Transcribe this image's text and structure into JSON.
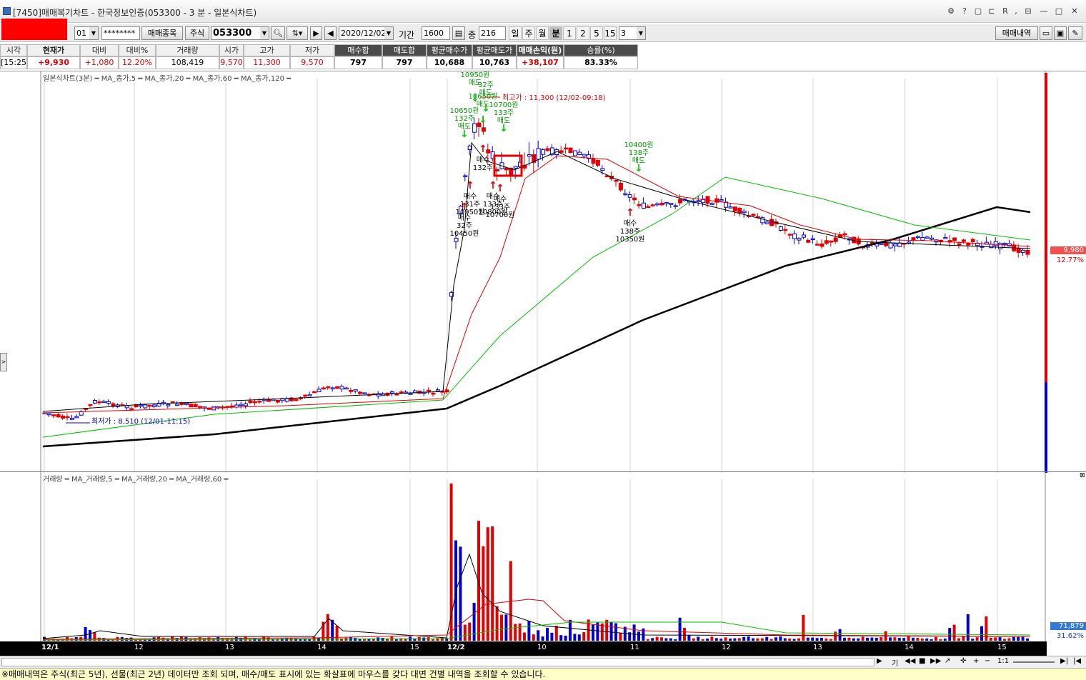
{
  "window": {
    "title": "[7450]매매복기차트 - 한국정보인증(053300 - 3 분 - 일본식차트)"
  },
  "toolbar": {
    "account_no": "01",
    "password": "********",
    "trade_item_button": "매매종목",
    "asset_type": "주식",
    "code": "053300",
    "date": "2020/12/02",
    "period_label": "기간",
    "period_count": "1600",
    "count_label": "중",
    "count_value": "216",
    "periods": [
      "일",
      "주",
      "월",
      "분",
      "1",
      "2",
      "5",
      "15"
    ],
    "selected_period": "분",
    "interval": "3",
    "history_button": "매매내역"
  },
  "quote": {
    "headers": [
      "시각",
      "현재가",
      "대비",
      "대비%",
      "거래량",
      "시가",
      "고가",
      "저가",
      "매수합",
      "매도합",
      "평균매수가",
      "평균매도가",
      "매매손익(원)",
      "승률(%)"
    ],
    "values": [
      "[15:25]",
      "+9,930",
      "+1,080",
      "12.20%",
      "108,419",
      "9,570",
      "11,300",
      "9,570",
      "797",
      "797",
      "10,688",
      "10,763",
      "+38,107",
      "83.33%"
    ]
  },
  "main_chart": {
    "legend": "일본식차트(3분) ━ MA_종가,5 ━ MA_종가,20 ━ MA_종가,60 ━ MA_종가,120 ━",
    "high_note": "최고가 : 11,300 (12/02-09:18)",
    "low_note": "최저가 : 8,510 (12/01-11:15)",
    "price_label": "9,980",
    "pct_label": "12.77%",
    "trade_marks": [
      {
        "side": "매도",
        "qty": "",
        "price": "10950원"
      },
      {
        "side": "매도",
        "qty": "32주",
        "price": ""
      },
      {
        "side": "매도",
        "qty": "",
        "price": "10650원"
      },
      {
        "side": "매도",
        "qty": "132주",
        "price": "10650원"
      },
      {
        "side": "매도",
        "qty": "133주",
        "price": "10700원"
      },
      {
        "side": "매도",
        "qty": "138주",
        "price": "10400원"
      },
      {
        "side": "매수",
        "qty": "32주",
        "price": "10450원"
      },
      {
        "side": "매수",
        "qty": "132주",
        "price": ""
      },
      {
        "side": "매수",
        "qty": "131주",
        "price": "10950원"
      },
      {
        "side": "매수",
        "qty": "133주",
        "price": "10800원"
      },
      {
        "side": "매수",
        "qty": "133주",
        "price": "10700원"
      },
      {
        "side": "매수",
        "qty": "138주",
        "price": "10350원"
      }
    ]
  },
  "volume_chart": {
    "legend": "거래량 ━ MA_거래량,5 ━ MA_거래량,20 ━ MA_거래량,60 ━",
    "vol_label": "71,879",
    "pct_label": "31.62%"
  },
  "x_axis": {
    "labels": [
      "12/1",
      "12",
      "13",
      "14",
      "15",
      "12/2",
      "10",
      "11",
      "12",
      "13",
      "14",
      "15"
    ]
  },
  "scroll": {
    "zoom_label": "1:1"
  },
  "status": {
    "message": "※매매내역은 주식(최근 5년), 선물(최근 2년) 데이터만 조회 되며, 매수/매도 표시에 있는 화살표에 마우스를 갖다 대면 건별 내역을 조회할 수 있습니다."
  },
  "colors": {
    "up": "#e00000",
    "down": "#0000cc",
    "ma5": "#000000",
    "ma20": "#e00000",
    "ma60": "#00c000",
    "ma120": "#000000",
    "sell_mark": "#00cc00",
    "buy_mark": "#dd0000"
  }
}
